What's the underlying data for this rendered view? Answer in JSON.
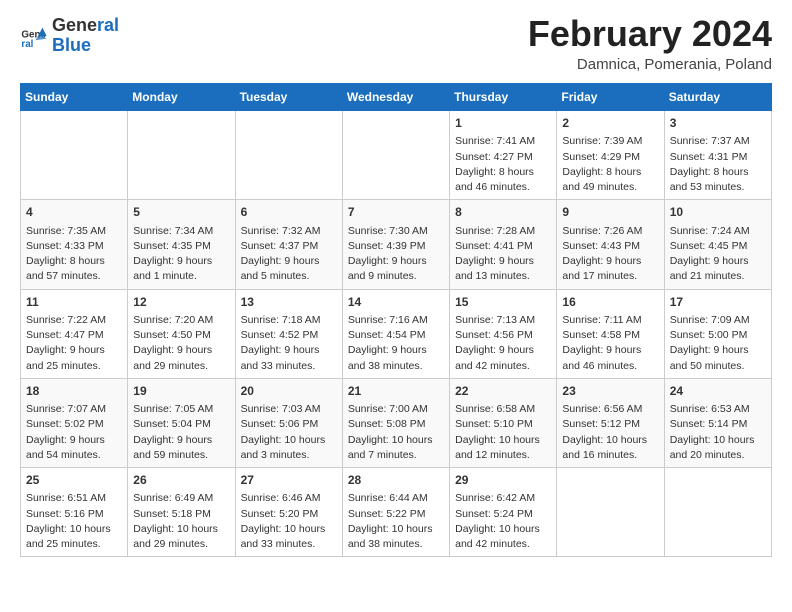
{
  "header": {
    "logo_line1": "General",
    "logo_line2": "Blue",
    "month_title": "February 2024",
    "subtitle": "Damnica, Pomerania, Poland"
  },
  "calendar": {
    "days_of_week": [
      "Sunday",
      "Monday",
      "Tuesday",
      "Wednesday",
      "Thursday",
      "Friday",
      "Saturday"
    ],
    "weeks": [
      [
        {
          "day": "",
          "text": ""
        },
        {
          "day": "",
          "text": ""
        },
        {
          "day": "",
          "text": ""
        },
        {
          "day": "",
          "text": ""
        },
        {
          "day": "1",
          "text": "Sunrise: 7:41 AM\nSunset: 4:27 PM\nDaylight: 8 hours\nand 46 minutes."
        },
        {
          "day": "2",
          "text": "Sunrise: 7:39 AM\nSunset: 4:29 PM\nDaylight: 8 hours\nand 49 minutes."
        },
        {
          "day": "3",
          "text": "Sunrise: 7:37 AM\nSunset: 4:31 PM\nDaylight: 8 hours\nand 53 minutes."
        }
      ],
      [
        {
          "day": "4",
          "text": "Sunrise: 7:35 AM\nSunset: 4:33 PM\nDaylight: 8 hours\nand 57 minutes."
        },
        {
          "day": "5",
          "text": "Sunrise: 7:34 AM\nSunset: 4:35 PM\nDaylight: 9 hours\nand 1 minute."
        },
        {
          "day": "6",
          "text": "Sunrise: 7:32 AM\nSunset: 4:37 PM\nDaylight: 9 hours\nand 5 minutes."
        },
        {
          "day": "7",
          "text": "Sunrise: 7:30 AM\nSunset: 4:39 PM\nDaylight: 9 hours\nand 9 minutes."
        },
        {
          "day": "8",
          "text": "Sunrise: 7:28 AM\nSunset: 4:41 PM\nDaylight: 9 hours\nand 13 minutes."
        },
        {
          "day": "9",
          "text": "Sunrise: 7:26 AM\nSunset: 4:43 PM\nDaylight: 9 hours\nand 17 minutes."
        },
        {
          "day": "10",
          "text": "Sunrise: 7:24 AM\nSunset: 4:45 PM\nDaylight: 9 hours\nand 21 minutes."
        }
      ],
      [
        {
          "day": "11",
          "text": "Sunrise: 7:22 AM\nSunset: 4:47 PM\nDaylight: 9 hours\nand 25 minutes."
        },
        {
          "day": "12",
          "text": "Sunrise: 7:20 AM\nSunset: 4:50 PM\nDaylight: 9 hours\nand 29 minutes."
        },
        {
          "day": "13",
          "text": "Sunrise: 7:18 AM\nSunset: 4:52 PM\nDaylight: 9 hours\nand 33 minutes."
        },
        {
          "day": "14",
          "text": "Sunrise: 7:16 AM\nSunset: 4:54 PM\nDaylight: 9 hours\nand 38 minutes."
        },
        {
          "day": "15",
          "text": "Sunrise: 7:13 AM\nSunset: 4:56 PM\nDaylight: 9 hours\nand 42 minutes."
        },
        {
          "day": "16",
          "text": "Sunrise: 7:11 AM\nSunset: 4:58 PM\nDaylight: 9 hours\nand 46 minutes."
        },
        {
          "day": "17",
          "text": "Sunrise: 7:09 AM\nSunset: 5:00 PM\nDaylight: 9 hours\nand 50 minutes."
        }
      ],
      [
        {
          "day": "18",
          "text": "Sunrise: 7:07 AM\nSunset: 5:02 PM\nDaylight: 9 hours\nand 54 minutes."
        },
        {
          "day": "19",
          "text": "Sunrise: 7:05 AM\nSunset: 5:04 PM\nDaylight: 9 hours\nand 59 minutes."
        },
        {
          "day": "20",
          "text": "Sunrise: 7:03 AM\nSunset: 5:06 PM\nDaylight: 10 hours\nand 3 minutes."
        },
        {
          "day": "21",
          "text": "Sunrise: 7:00 AM\nSunset: 5:08 PM\nDaylight: 10 hours\nand 7 minutes."
        },
        {
          "day": "22",
          "text": "Sunrise: 6:58 AM\nSunset: 5:10 PM\nDaylight: 10 hours\nand 12 minutes."
        },
        {
          "day": "23",
          "text": "Sunrise: 6:56 AM\nSunset: 5:12 PM\nDaylight: 10 hours\nand 16 minutes."
        },
        {
          "day": "24",
          "text": "Sunrise: 6:53 AM\nSunset: 5:14 PM\nDaylight: 10 hours\nand 20 minutes."
        }
      ],
      [
        {
          "day": "25",
          "text": "Sunrise: 6:51 AM\nSunset: 5:16 PM\nDaylight: 10 hours\nand 25 minutes."
        },
        {
          "day": "26",
          "text": "Sunrise: 6:49 AM\nSunset: 5:18 PM\nDaylight: 10 hours\nand 29 minutes."
        },
        {
          "day": "27",
          "text": "Sunrise: 6:46 AM\nSunset: 5:20 PM\nDaylight: 10 hours\nand 33 minutes."
        },
        {
          "day": "28",
          "text": "Sunrise: 6:44 AM\nSunset: 5:22 PM\nDaylight: 10 hours\nand 38 minutes."
        },
        {
          "day": "29",
          "text": "Sunrise: 6:42 AM\nSunset: 5:24 PM\nDaylight: 10 hours\nand 42 minutes."
        },
        {
          "day": "",
          "text": ""
        },
        {
          "day": "",
          "text": ""
        }
      ]
    ]
  }
}
